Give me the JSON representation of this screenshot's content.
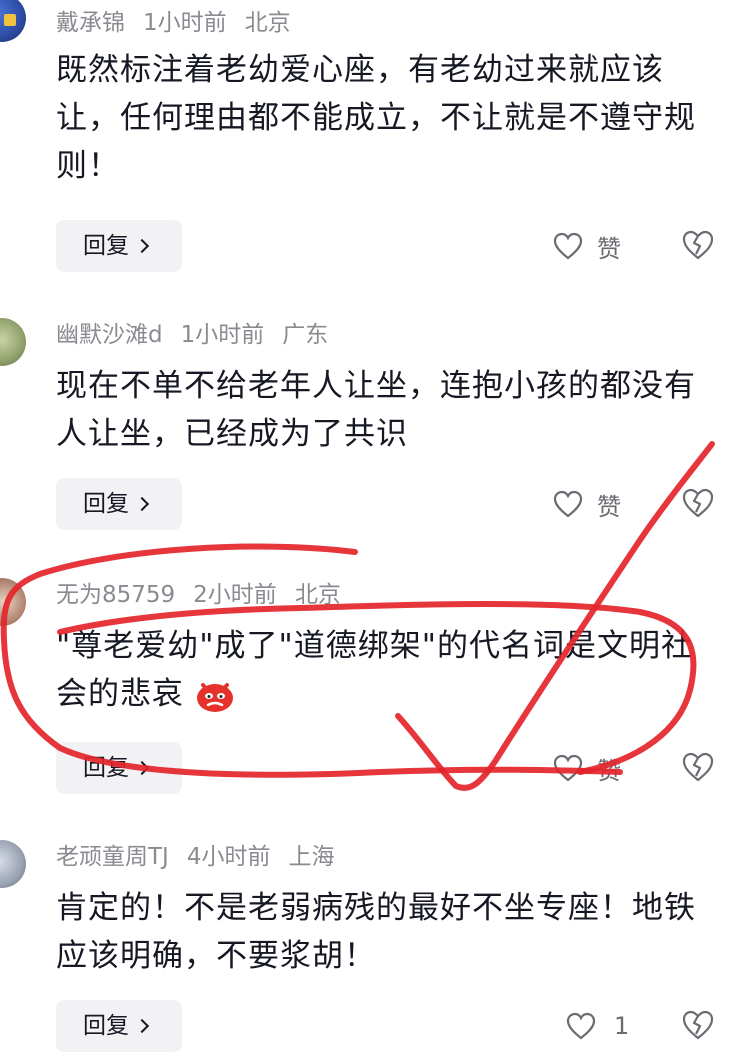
{
  "comments": [
    {
      "username": "戴承锦",
      "time": "1小时前",
      "location": "北京",
      "text": "既然标注着老幼爱心座，有老幼过来就应该让，任何理由都不能成立，不让就是不遵守规则！",
      "reply_label": "回复",
      "like_label": "赞"
    },
    {
      "username": "幽默沙滩d",
      "time": "1小时前",
      "location": "广东",
      "text": "现在不单不给老年人让坐，连抱小孩的都没有人让坐，已经成为了共识",
      "reply_label": "回复",
      "like_label": "赞"
    },
    {
      "username": "无为85759",
      "time": "2小时前",
      "location": "北京",
      "text": "\"尊老爱幼\"成了\"道德绑架\"的代名词是文明社会的悲哀",
      "reply_label": "回复",
      "like_label": "赞"
    },
    {
      "username": "老顽童周TJ",
      "time": "4小时前",
      "location": "上海",
      "text": "肯定的！不是老弱病残的最好不坐专座！地铁应该明确，不要浆胡！",
      "reply_label": "回复",
      "like_label": "1"
    }
  ],
  "icons": {
    "like": "heart-outline-icon",
    "dislike": "broken-heart-icon",
    "reply_chevron": "chevron-right-icon",
    "emoji": "angry-face-emoji"
  },
  "colors": {
    "annotation_red": "#e4252b",
    "meta_gray": "#8a8b91",
    "text": "#161823",
    "button_bg": "#f2f2f4"
  }
}
